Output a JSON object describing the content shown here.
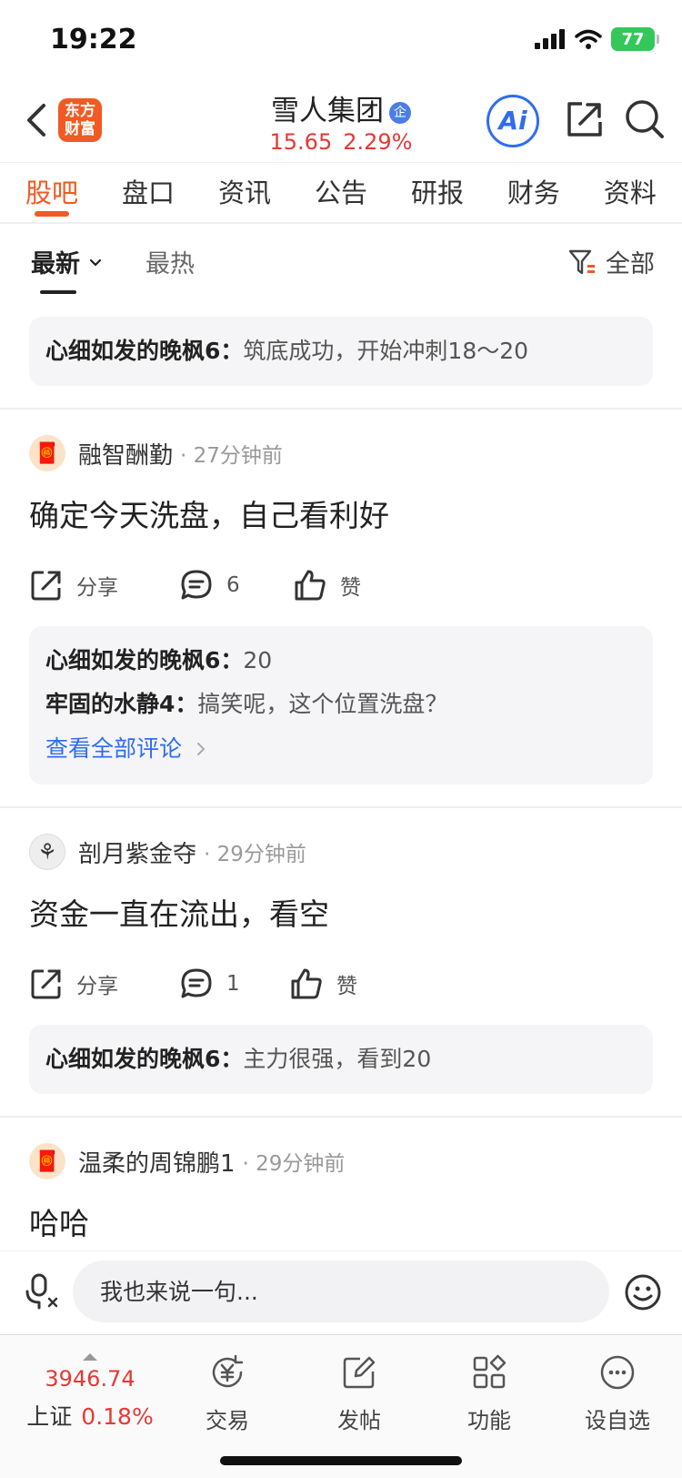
{
  "status": {
    "time": "19:22",
    "battery": "77"
  },
  "header": {
    "logo_line1": "东方",
    "logo_line2": "财富",
    "stock_name": "雪人集团",
    "verified_badge": "企",
    "price": "15.65",
    "change_pct": "2.29%",
    "ai_label": "Ai",
    "accent_color": "#f15a22",
    "rise_color": "#e53935",
    "link_color": "#2f6df0"
  },
  "tabs": [
    "股吧",
    "盘口",
    "资讯",
    "公告",
    "研报",
    "财务",
    "资料"
  ],
  "sort": {
    "latest": "最新",
    "hot": "最热",
    "filter": "全部"
  },
  "feed": {
    "top_reply": {
      "user": "心细如发的晚枫6：",
      "text": "筑底成功，开始冲刺18～20"
    },
    "posts": [
      {
        "author": "融智酬勤",
        "time": "· 27分钟前",
        "text": "确定今天洗盘，自己看利好",
        "share": "分享",
        "comments": "6",
        "like": "赞",
        "replies": [
          {
            "user": "心细如发的晚枫6：",
            "text": "20"
          },
          {
            "user": "牢固的水静4：",
            "text": "搞笑呢，这个位置洗盘？"
          }
        ],
        "view_all": "查看全部评论"
      },
      {
        "author": "剖月紫金夺",
        "time": "· 29分钟前",
        "text": "资金一直在流出，看空",
        "share": "分享",
        "comments": "1",
        "like": "赞",
        "replies": [
          {
            "user": "心细如发的晚枫6：",
            "text": "主力很强，看到20"
          }
        ]
      },
      {
        "author": "温柔的周锦鹏1",
        "time": "· 29分钟前",
        "text": "哈哈"
      }
    ]
  },
  "input": {
    "placeholder": "我也来说一句..."
  },
  "bottom": {
    "index_value": "3946.74",
    "index_name": "上证",
    "index_pct": "0.18%",
    "nav": [
      "交易",
      "发帖",
      "功能",
      "设自选"
    ]
  }
}
